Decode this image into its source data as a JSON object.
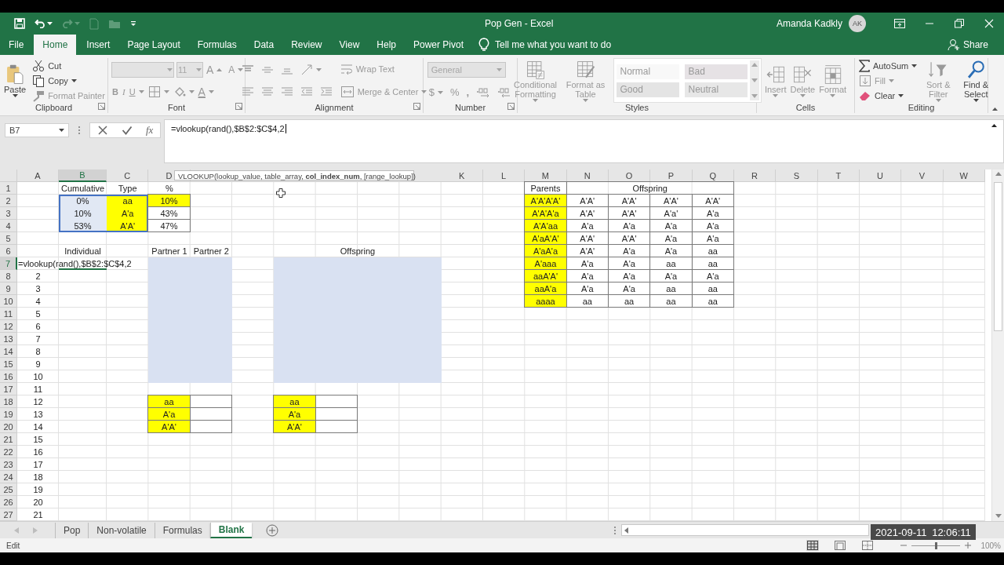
{
  "quick_access": [
    {
      "kind": "save",
      "disabled": false,
      "menu": false
    },
    {
      "kind": "undo",
      "disabled": false,
      "menu": true
    },
    {
      "kind": "redo",
      "disabled": true,
      "menu": true
    },
    {
      "kind": "new",
      "disabled": true,
      "menu": false
    },
    {
      "kind": "open",
      "disabled": true,
      "menu": false
    },
    {
      "kind": "customize",
      "disabled": false,
      "menu": false
    }
  ],
  "window": {
    "title": "Pop Gen  -  Excel",
    "user": "Amanda Kadkly",
    "avatar": "AK"
  },
  "tabs": [
    {
      "label": "File",
      "selected": false
    },
    {
      "label": "Home",
      "selected": true
    },
    {
      "label": "Insert",
      "selected": false
    },
    {
      "label": "Page Layout",
      "selected": false
    },
    {
      "label": "Formulas",
      "selected": false
    },
    {
      "label": "Data",
      "selected": false
    },
    {
      "label": "Review",
      "selected": false
    },
    {
      "label": "View",
      "selected": false
    },
    {
      "label": "Help",
      "selected": false
    },
    {
      "label": "Power Pivot",
      "selected": false
    }
  ],
  "tell_me": {
    "placeholder": "Tell me what you want to do"
  },
  "share": "Share",
  "ribbon": [
    {
      "label": "Clipboard",
      "launcher": true,
      "columns": [
        [
          [
            {
              "kind": "paste",
              "label": "Paste",
              "disabled": false,
              "menu": true
            }
          ]
        ],
        [
          [
            {
              "kind": "cut",
              "label": "Cut",
              "disabled": false,
              "menu": false
            }
          ],
          [
            {
              "kind": "copy",
              "label": "Copy",
              "disabled": false,
              "menu": true
            }
          ],
          [
            {
              "kind": "format_painter",
              "label": "Format Painter",
              "disabled": true,
              "menu": false
            }
          ]
        ]
      ]
    },
    {
      "label": "Font",
      "launcher": true,
      "columns": [
        [
          [
            {
              "kind": "font_name",
              "disabled": true,
              "menu": true
            },
            {
              "kind": "font_size",
              "label": "11",
              "disabled": true,
              "menu": true
            },
            {
              "kind": "grow",
              "label": "A",
              "disabled": true,
              "menu": false
            },
            {
              "kind": "shrink",
              "label": "A",
              "disabled": true,
              "menu": false
            }
          ],
          [
            {
              "kind": "bold",
              "label": "B",
              "disabled": true,
              "menu": false
            },
            {
              "kind": "italic",
              "label": "I",
              "disabled": true,
              "menu": false
            },
            {
              "kind": "underline",
              "label": "U",
              "disabled": true,
              "menu": true
            },
            {
              "kind": "borders",
              "disabled": true,
              "menu": true
            },
            {
              "kind": "fill_color",
              "disabled": true,
              "menu": true
            },
            {
              "kind": "font_color",
              "label": "A",
              "disabled": true,
              "menu": true
            }
          ]
        ]
      ]
    },
    {
      "label": "Alignment",
      "launcher": true,
      "columns": [
        [
          [
            {
              "kind": "align_top",
              "disabled": true,
              "menu": false
            },
            {
              "kind": "align_middle",
              "disabled": true,
              "menu": false
            },
            {
              "kind": "align_bottom",
              "disabled": true,
              "menu": false
            },
            {
              "kind": "orientation",
              "disabled": true,
              "menu": true
            }
          ],
          [
            {
              "kind": "align_left",
              "disabled": true,
              "menu": false
            },
            {
              "kind": "align_center",
              "disabled": true,
              "menu": false
            },
            {
              "kind": "align_right",
              "disabled": true,
              "menu": false
            },
            {
              "kind": "indent_decrease",
              "disabled": true,
              "menu": false
            },
            {
              "kind": "indent_increase",
              "disabled": true,
              "menu": false
            }
          ]
        ],
        [
          [
            {
              "kind": "wrap_text",
              "label": "Wrap Text",
              "disabled": true,
              "menu": false
            }
          ],
          [
            {
              "kind": "merge",
              "label": "Merge & Center",
              "disabled": true,
              "menu": true
            }
          ]
        ]
      ]
    },
    {
      "label": "Number",
      "launcher": true,
      "columns": [
        [
          [
            {
              "kind": "number_format",
              "label": "General",
              "disabled": true,
              "menu": true
            }
          ],
          [
            {
              "kind": "currency",
              "label": "$",
              "disabled": true,
              "menu": true
            },
            {
              "kind": "percent",
              "label": "%",
              "disabled": true,
              "menu": false
            },
            {
              "kind": "comma",
              "label": ",",
              "disabled": true,
              "menu": false
            },
            {
              "kind": "decimal_increase",
              "disabled": true,
              "menu": false
            },
            {
              "kind": "decimal_decrease",
              "disabled": true,
              "menu": false
            }
          ]
        ]
      ]
    },
    {
      "label": "Styles",
      "columns": [
        [
          [
            {
              "kind": "conditional_formatting",
              "label": "Conditional Formatting",
              "disabled": true,
              "menu": true
            }
          ]
        ],
        [
          [
            {
              "kind": "format_as_table",
              "label": "Format as Table",
              "disabled": true,
              "menu": true
            }
          ]
        ],
        [
          [
            {
              "kind": "style",
              "label": "Normal",
              "disabled": true,
              "color": "#f8f8f8"
            },
            {
              "kind": "style",
              "label": "Bad",
              "disabled": true,
              "color": "#e6e2e5"
            }
          ],
          [
            {
              "kind": "style",
              "label": "Good",
              "disabled": true,
              "color": "#e4e4e4"
            },
            {
              "kind": "style",
              "label": "Neutral",
              "disabled": true,
              "color": "#e7e7e7"
            }
          ]
        ]
      ]
    },
    {
      "label": "Cells",
      "columns": [
        [
          [
            {
              "kind": "insert",
              "label": "Insert",
              "disabled": true,
              "menu": true
            }
          ]
        ],
        [
          [
            {
              "kind": "delete",
              "label": "Delete",
              "disabled": true,
              "menu": true
            }
          ]
        ],
        [
          [
            {
              "kind": "format",
              "label": "Format",
              "disabled": true,
              "menu": true
            }
          ]
        ]
      ]
    },
    {
      "label": "Editing",
      "columns": [
        [
          [
            {
              "kind": "autosum",
              "label": "AutoSum",
              "disabled": false,
              "menu": true
            }
          ],
          [
            {
              "kind": "fill_down",
              "label": "Fill",
              "disabled": true,
              "menu": true
            }
          ],
          [
            {
              "kind": "clear",
              "label": "Clear",
              "disabled": false,
              "menu": true
            }
          ]
        ],
        [
          [
            {
              "kind": "sort_filter",
              "label": "Sort & Filter",
              "disabled": true,
              "menu": true
            }
          ]
        ],
        [
          [
            {
              "kind": "find_select",
              "label": "Find & Select",
              "disabled": false,
              "menu": true
            }
          ]
        ]
      ]
    }
  ],
  "formula_bar": {
    "name_box": "B7",
    "function_label": "fx",
    "formula": "=vlookup(rand(),$B$2:$C$4,2"
  },
  "sheet": {
    "tooltip": "VLOOKUP(lookup_value, table_array, **col_index_num**, [range_lookup])",
    "columns_left": [
      {
        "label": "A",
        "selected": false
      },
      {
        "label": "B",
        "selected": true
      },
      {
        "label": "C",
        "selected": false
      },
      {
        "label": "D",
        "selected": false
      }
    ],
    "columns_right": [
      {
        "label": "K",
        "selected": false
      },
      {
        "label": "L",
        "selected": false
      },
      {
        "label": "M",
        "selected": false
      },
      {
        "label": "N",
        "selected": false
      },
      {
        "label": "O",
        "selected": false
      },
      {
        "label": "P",
        "selected": false
      },
      {
        "label": "Q",
        "selected": false
      },
      {
        "label": "R",
        "selected": false
      },
      {
        "label": "S",
        "selected": false
      },
      {
        "label": "T",
        "selected": false
      },
      {
        "label": "U",
        "selected": false
      },
      {
        "label": "V",
        "selected": false
      },
      {
        "label": "W",
        "selected": false
      }
    ],
    "rows": [
      {
        "label": "1",
        "selected": false
      },
      {
        "label": "2",
        "selected": false
      },
      {
        "label": "3",
        "selected": false
      },
      {
        "label": "4",
        "selected": false
      },
      {
        "label": "5",
        "selected": false
      },
      {
        "label": "6",
        "selected": false
      },
      {
        "label": "7",
        "selected": true
      },
      {
        "label": "8",
        "selected": false
      },
      {
        "label": "9",
        "selected": false
      },
      {
        "label": "10",
        "selected": false
      },
      {
        "label": "11",
        "selected": false
      },
      {
        "label": "12",
        "selected": false
      },
      {
        "label": "13",
        "selected": false
      },
      {
        "label": "14",
        "selected": false
      },
      {
        "label": "15",
        "selected": false
      },
      {
        "label": "16",
        "selected": false
      },
      {
        "label": "17",
        "selected": false
      },
      {
        "label": "18",
        "selected": false
      },
      {
        "label": "19",
        "selected": false
      },
      {
        "label": "20",
        "selected": false
      },
      {
        "label": "21",
        "selected": false
      },
      {
        "label": "22",
        "selected": false
      },
      {
        "label": "23",
        "selected": false
      },
      {
        "label": "24",
        "selected": false
      },
      {
        "label": "25",
        "selected": false
      },
      {
        "label": "26",
        "selected": false
      },
      {
        "label": "27",
        "selected": false
      }
    ],
    "editing": {
      "text": "=vlookup(rand(),$B$2:$C$4,2"
    },
    "blocks": [
      {
        "kind": "table",
        "reference_outline": true,
        "rows": [
          [
            {
              "text": "Cumulative",
              "bordered": false
            },
            {
              "text": "Type",
              "bordered": false
            },
            {
              "text": "%",
              "bordered": false
            }
          ],
          [
            {
              "text": "0%",
              "bordered": false,
              "color": "#e1e8f4"
            },
            {
              "text": "aa",
              "bordered": false,
              "color": "#ffff00"
            },
            {
              "text": "10%",
              "bordered": true,
              "color": "#ffff00"
            }
          ],
          [
            {
              "text": "10%",
              "bordered": false,
              "color": "#e1e8f4"
            },
            {
              "text": "A'a",
              "bordered": false,
              "color": "#ffff00"
            },
            {
              "text": "43%",
              "bordered": true
            }
          ],
          [
            {
              "text": "53%",
              "bordered": false,
              "color": "#e1e8f4"
            },
            {
              "text": "A'A'",
              "bordered": false,
              "color": "#ffff00"
            },
            {
              "text": "47%",
              "bordered": true
            }
          ]
        ]
      },
      {
        "kind": "table",
        "rows": [
          [
            {
              "text": "Individual",
              "bordered": false
            }
          ]
        ]
      },
      {
        "kind": "table",
        "rows": [
          [
            {
              "text": "Partner 1",
              "bordered": false
            },
            {
              "text": "Partner 2",
              "bordered": false
            }
          ]
        ]
      },
      {
        "kind": "table",
        "rows": [
          [
            {
              "text": "Offspring",
              "bordered": false,
              "merged": true
            }
          ]
        ]
      },
      {
        "kind": "fill",
        "color": "#d9e1f2"
      },
      {
        "kind": "fill",
        "color": "#d9e1f2"
      },
      {
        "kind": "table",
        "rows": [
          [
            {
              "text": "2",
              "bordered": false
            }
          ],
          [
            {
              "text": "3",
              "bordered": false
            }
          ],
          [
            {
              "text": "4",
              "bordered": false
            }
          ],
          [
            {
              "text": "5",
              "bordered": false
            }
          ],
          [
            {
              "text": "6",
              "bordered": false
            }
          ],
          [
            {
              "text": "7",
              "bordered": false
            }
          ],
          [
            {
              "text": "8",
              "bordered": false
            }
          ],
          [
            {
              "text": "9",
              "bordered": false
            }
          ],
          [
            {
              "text": "10",
              "bordered": false
            }
          ],
          [
            {
              "text": "11",
              "bordered": false
            }
          ],
          [
            {
              "text": "12",
              "bordered": false
            }
          ],
          [
            {
              "text": "13",
              "bordered": false
            }
          ],
          [
            {
              "text": "14",
              "bordered": false
            }
          ],
          [
            {
              "text": "15",
              "bordered": false
            }
          ],
          [
            {
              "text": "16",
              "bordered": false
            }
          ],
          [
            {
              "text": "17",
              "bordered": false
            }
          ],
          [
            {
              "text": "18",
              "bordered": false
            }
          ],
          [
            {
              "text": "19",
              "bordered": false
            }
          ],
          [
            {
              "text": "20",
              "bordered": false
            }
          ],
          [
            {
              "text": "21",
              "bordered": false
            }
          ]
        ]
      },
      {
        "kind": "table",
        "rows": [
          [
            {
              "text": "aa",
              "bordered": true,
              "color": "#ffff00"
            },
            {
              "bordered": true
            }
          ],
          [
            {
              "text": "A'a",
              "bordered": true,
              "color": "#ffff00"
            },
            {
              "bordered": true
            }
          ],
          [
            {
              "text": "A'A'",
              "bordered": true,
              "color": "#ffff00"
            },
            {
              "bordered": true
            }
          ]
        ]
      },
      {
        "kind": "table",
        "rows": [
          [
            {
              "text": "aa",
              "bordered": true,
              "color": "#ffff00"
            },
            {
              "bordered": true
            }
          ],
          [
            {
              "text": "A'a",
              "bordered": true,
              "color": "#ffff00"
            },
            {
              "bordered": true
            }
          ],
          [
            {
              "text": "A'A'",
              "bordered": true,
              "color": "#ffff00"
            },
            {
              "bordered": true
            }
          ]
        ]
      },
      {
        "kind": "table",
        "rows": [
          [
            {
              "text": "Parents",
              "bordered": true
            },
            {
              "text": "Offspring",
              "bordered": true,
              "merged": true
            }
          ],
          [
            {
              "text": "A'A'A'A'",
              "bordered": true,
              "color": "#ffff00"
            },
            {
              "text": "A'A'",
              "bordered": true
            },
            {
              "text": "A'A'",
              "bordered": true
            },
            {
              "text": "A'A'",
              "bordered": true
            },
            {
              "text": "A'A'",
              "bordered": true
            }
          ],
          [
            {
              "text": "A'A'A'a",
              "bordered": true,
              "color": "#ffff00"
            },
            {
              "text": "A'A'",
              "bordered": true
            },
            {
              "text": "A'A'",
              "bordered": true
            },
            {
              "text": "A'a'",
              "bordered": true
            },
            {
              "text": "A'a",
              "bordered": true
            }
          ],
          [
            {
              "text": "A'A'aa",
              "bordered": true,
              "color": "#ffff00"
            },
            {
              "text": "A'a",
              "bordered": true
            },
            {
              "text": "A'a",
              "bordered": true
            },
            {
              "text": "A'a",
              "bordered": true
            },
            {
              "text": "A'a",
              "bordered": true
            }
          ],
          [
            {
              "text": "A'aA'A'",
              "bordered": true,
              "color": "#ffff00"
            },
            {
              "text": "A'A'",
              "bordered": true
            },
            {
              "text": "A'A'",
              "bordered": true
            },
            {
              "text": "A'a",
              "bordered": true
            },
            {
              "text": "A'a",
              "bordered": true
            }
          ],
          [
            {
              "text": "A'aA'a",
              "bordered": true,
              "color": "#ffff00"
            },
            {
              "text": "A'A'",
              "bordered": true
            },
            {
              "text": "A'a",
              "bordered": true
            },
            {
              "text": "A'a",
              "bordered": true
            },
            {
              "text": "aa",
              "bordered": true
            }
          ],
          [
            {
              "text": "A'aaa",
              "bordered": true,
              "color": "#ffff00"
            },
            {
              "text": "A'a",
              "bordered": true
            },
            {
              "text": "A'a",
              "bordered": true
            },
            {
              "text": "aa",
              "bordered": true
            },
            {
              "text": "aa",
              "bordered": true
            }
          ],
          [
            {
              "text": "aaA'A'",
              "bordered": true,
              "color": "#ffff00"
            },
            {
              "text": "A'a",
              "bordered": true
            },
            {
              "text": "A'a",
              "bordered": true
            },
            {
              "text": "A'a",
              "bordered": true
            },
            {
              "text": "A'a",
              "bordered": true
            }
          ],
          [
            {
              "text": "aaA'a",
              "bordered": true,
              "color": "#ffff00"
            },
            {
              "text": "A'a",
              "bordered": true
            },
            {
              "text": "A'a",
              "bordered": true
            },
            {
              "text": "aa",
              "bordered": true
            },
            {
              "text": "aa",
              "bordered": true
            }
          ],
          [
            {
              "text": "aaaa",
              "bordered": true,
              "color": "#ffff00"
            },
            {
              "text": "aa",
              "bordered": true
            },
            {
              "text": "aa",
              "bordered": true
            },
            {
              "text": "aa",
              "bordered": true
            },
            {
              "text": "aa",
              "bordered": true
            }
          ]
        ]
      }
    ]
  },
  "sheet_nav": [
    {
      "kind": "previous",
      "disabled": true
    },
    {
      "kind": "next",
      "disabled": true
    }
  ],
  "sheet_tabs": [
    {
      "label": "Pop",
      "selected": false
    },
    {
      "label": "Non-volatile",
      "selected": false
    },
    {
      "label": "Formulas",
      "selected": false
    },
    {
      "label": "Blank",
      "selected": true
    }
  ],
  "status_bar": {
    "mode": "Edit",
    "views": [
      {
        "kind": "normal",
        "selected": true
      },
      {
        "kind": "page_layout",
        "selected": false
      },
      {
        "kind": "page_break",
        "selected": false
      }
    ],
    "zoom": {
      "level": 0.5,
      "reading": "100%"
    }
  },
  "overlay_timestamp": "2021-09-11 12:06:11"
}
